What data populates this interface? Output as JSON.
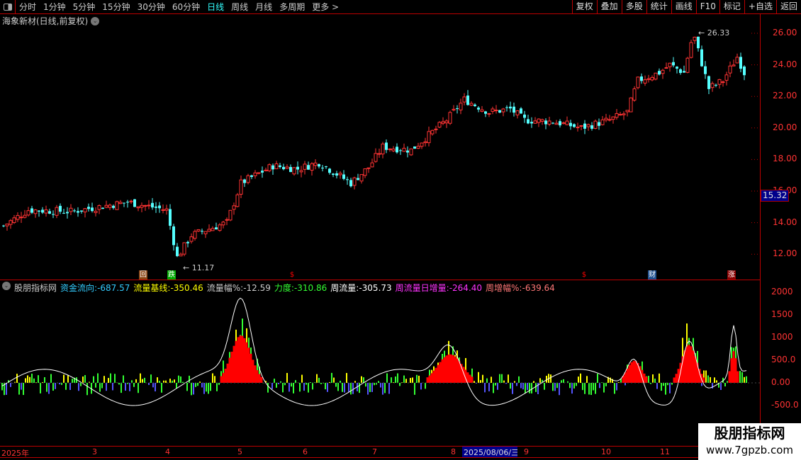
{
  "toolbar": {
    "periods": [
      "分时",
      "1分钟",
      "5分钟",
      "15分钟",
      "30分钟",
      "60分钟",
      "日线",
      "周线",
      "月线",
      "多周期",
      "更多 >"
    ],
    "active": "日线",
    "right": [
      "复权",
      "叠加",
      "多股",
      "统计",
      "画线",
      "F10",
      "标记",
      "+自选",
      "返回"
    ]
  },
  "chart_title": "海象新材(日线,前复权)",
  "price_axis": [
    "26.00",
    "24.00",
    "22.00",
    "20.00",
    "18.00",
    "16.00",
    "14.00",
    "12.00"
  ],
  "current_price": "15.32",
  "high_label": "26.33",
  "low_label": "11.17",
  "markers": [
    {
      "char": "回",
      "color": "#8b4513"
    },
    {
      "char": "跌",
      "color": "#0a0"
    },
    {
      "char": "$",
      "color": "#f00"
    },
    {
      "char": "$",
      "color": "#f00"
    },
    {
      "char": "财",
      "color": "#1e4f8f"
    },
    {
      "char": "涨",
      "color": "#8b0000"
    }
  ],
  "price_path": [
    [
      5,
      13.8
    ],
    [
      40,
      14.8
    ],
    [
      100,
      14.7
    ],
    [
      180,
      15.3
    ],
    [
      235,
      14.8
    ],
    [
      250,
      11.8
    ],
    [
      270,
      13.2
    ],
    [
      320,
      14
    ],
    [
      340,
      16.5
    ],
    [
      385,
      17.6
    ],
    [
      420,
      17.4
    ],
    [
      450,
      17.8
    ],
    [
      495,
      16.5
    ],
    [
      520,
      17.5
    ],
    [
      540,
      18.8
    ],
    [
      580,
      18.6
    ],
    [
      630,
      20.5
    ],
    [
      655,
      21.8
    ],
    [
      690,
      21.0
    ],
    [
      720,
      21.2
    ],
    [
      740,
      20.5
    ],
    [
      780,
      20.4
    ],
    [
      820,
      20.0
    ],
    [
      860,
      20.5
    ],
    [
      885,
      21.0
    ],
    [
      900,
      23.0
    ],
    [
      930,
      23.5
    ],
    [
      945,
      24.0
    ],
    [
      965,
      23.5
    ],
    [
      978,
      26.0
    ],
    [
      1000,
      22.5
    ],
    [
      1020,
      23.0
    ],
    [
      1040,
      24.5
    ],
    [
      1052,
      23.3
    ]
  ],
  "indicator": {
    "name": "股朋指标网",
    "items": [
      {
        "label": "资金流向:",
        "value": "-687.57",
        "color": "#3cf"
      },
      {
        "label": "流量基线:",
        "value": "-350.46",
        "color": "#ff0"
      },
      {
        "label": "流量幅%:",
        "value": "-12.59",
        "color": "#ccc"
      },
      {
        "label": "力度:",
        "value": "-310.86",
        "color": "#3f3"
      },
      {
        "label": "周流量:",
        "value": "-305.73",
        "color": "#fff"
      },
      {
        "label": "周流量日增量:",
        "value": "-264.40",
        "color": "#f3f"
      },
      {
        "label": "周增幅%:",
        "value": "-639.64",
        "color": "#f77"
      }
    ],
    "axis": [
      "2000",
      "1500",
      "1000",
      "500.0",
      "0.00",
      "-500.0"
    ]
  },
  "dates": {
    "labels": [
      "2025年",
      "3",
      "4",
      "5",
      "6",
      "7",
      "8",
      "9",
      "10",
      "11"
    ],
    "highlight": "2025/08/06/三"
  },
  "watermark": {
    "title": "股朋指标网",
    "url": "www.7gpzb.com"
  }
}
